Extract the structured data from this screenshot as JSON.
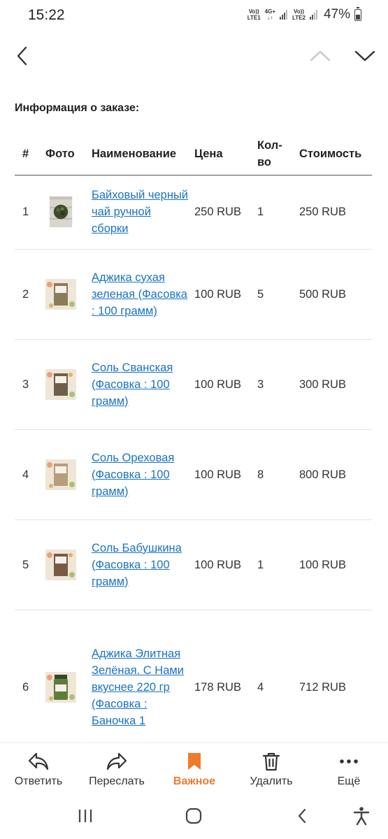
{
  "status": {
    "time": "15:22",
    "sim1_top": "Vo))",
    "sim1_bottom": "LTE1",
    "net_top": "4G+",
    "net_bottom": "↓↑",
    "sim2_top": "Vo))",
    "sim2_bottom": "LTE2",
    "battery": "47%"
  },
  "topnav": {
    "back_icon": "chevron-left-icon",
    "prev_icon": "chevron-up-icon",
    "next_icon": "chevron-down-icon"
  },
  "section_title": "Информация о заказе:",
  "table": {
    "headers": {
      "num": "#",
      "photo": "Фото",
      "name": "Наименование",
      "price": "Цена",
      "qty": "Кол-во",
      "cost": "Стоимость"
    },
    "rows": [
      {
        "num": "1",
        "name": "Байховый черный чай ручной сборки",
        "price": "250 RUB",
        "qty": "1",
        "cost": "250 RUB"
      },
      {
        "num": "2",
        "name": "Аджика сухая зеленая (Фасовка : 100 грамм)",
        "price": "100 RUB",
        "qty": "5",
        "cost": "500 RUB"
      },
      {
        "num": "3",
        "name": "Соль Сванская (Фасовка : 100 грамм)",
        "price": "100 RUB",
        "qty": "3",
        "cost": "300 RUB"
      },
      {
        "num": "4",
        "name": "Соль Ореховая (Фасовка : 100 грамм)",
        "price": "100 RUB",
        "qty": "8",
        "cost": "800 RUB"
      },
      {
        "num": "5",
        "name": "Соль Бабушкина (Фасовка : 100 грамм)",
        "price": "100 RUB",
        "qty": "1",
        "cost": "100 RUB"
      },
      {
        "num": "6",
        "name": "Аджика Элитная Зелёная. С Нами вкуснее 220 гр (Фасовка : Баночка 1",
        "price": "178 RUB",
        "qty": "4",
        "cost": "712 RUB"
      }
    ]
  },
  "actions": {
    "reply": "Ответить",
    "forward": "Переслать",
    "important": "Важное",
    "delete": "Удалить",
    "more": "Ещё"
  },
  "colors": {
    "link": "#1a73c4",
    "accent": "#f07a2a"
  }
}
